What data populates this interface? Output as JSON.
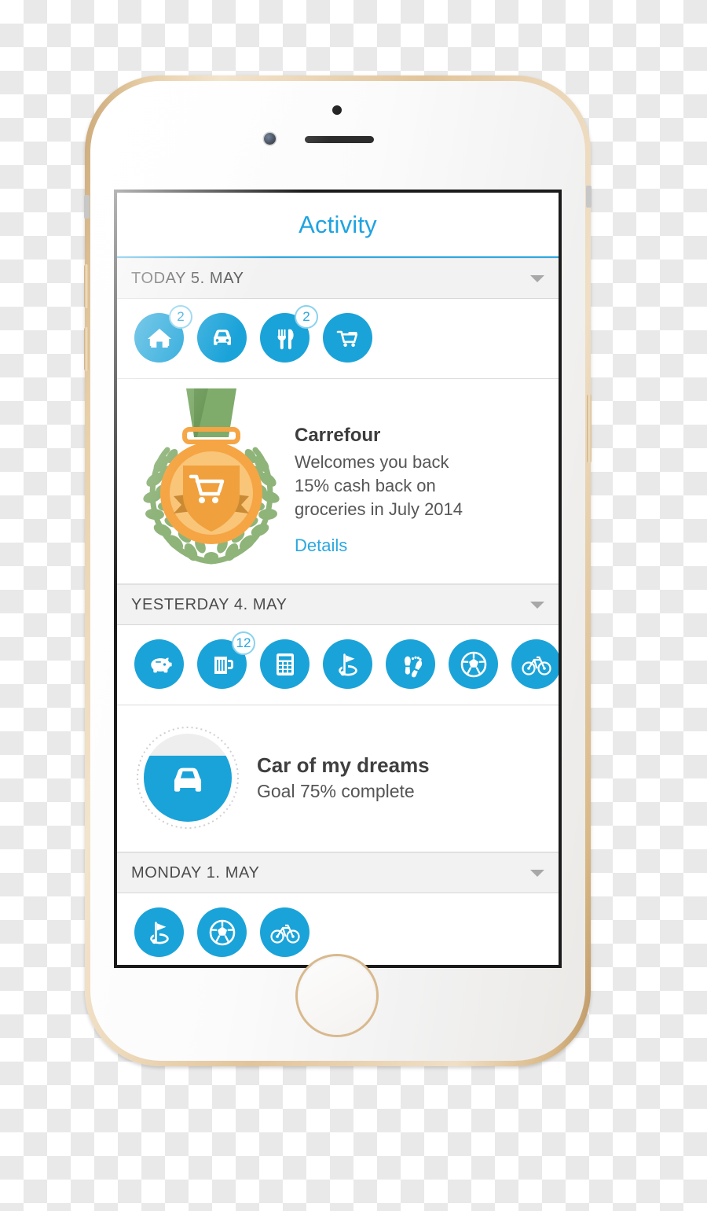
{
  "app": {
    "nav_title": "Activity"
  },
  "sections": [
    {
      "id": "today",
      "header_label": "TODAY 5. MAY",
      "chevron_icon": "chevron-down-icon",
      "icons": [
        {
          "name": "home-icon",
          "badge": "2"
        },
        {
          "name": "car-icon",
          "badge": null
        },
        {
          "name": "dining-icon",
          "badge": "2"
        },
        {
          "name": "shopping-cart-icon",
          "badge": null
        }
      ]
    },
    {
      "id": "yesterday",
      "header_label": "YESTERDAY 4. MAY",
      "chevron_icon": "chevron-down-icon",
      "icons": [
        {
          "name": "piggy-bank-icon",
          "badge": null
        },
        {
          "name": "beer-mug-icon",
          "badge": "12"
        },
        {
          "name": "calculator-icon",
          "badge": null
        },
        {
          "name": "golf-icon",
          "badge": null
        },
        {
          "name": "footsteps-icon",
          "badge": null
        },
        {
          "name": "soccer-ball-icon",
          "badge": null
        },
        {
          "name": "bicycle-icon",
          "badge": null
        }
      ]
    },
    {
      "id": "monday",
      "header_label": "MONDAY 1. MAY",
      "chevron_icon": "chevron-down-icon",
      "icons": [
        {
          "name": "golf-icon",
          "badge": null
        },
        {
          "name": "soccer-ball-icon",
          "badge": null
        },
        {
          "name": "bicycle-icon",
          "badge": null
        }
      ]
    }
  ],
  "promo_card": {
    "art_icon": "award-medal-icon",
    "merchant": "Carrefour",
    "line1": "Welcomes you back",
    "line2": "15% cash back on",
    "line3": "groceries in July 2014",
    "details_link": "Details"
  },
  "goal_card": {
    "art_icon": "car-progress-icon",
    "title": "Car of my dreams",
    "subtitle": "Goal 75% complete",
    "progress_percent": 75
  },
  "colors": {
    "accent_blue": "#1aa3d9",
    "nav_blue": "#1fa3e0",
    "badge_border": "#8ad2ee",
    "header_grey": "#f2f2f2",
    "medal_gold": "#f5a544",
    "medal_gold_light": "#f9c579",
    "ribbon_green": "#7fab6b",
    "laurel_green": "#8fb47a"
  }
}
